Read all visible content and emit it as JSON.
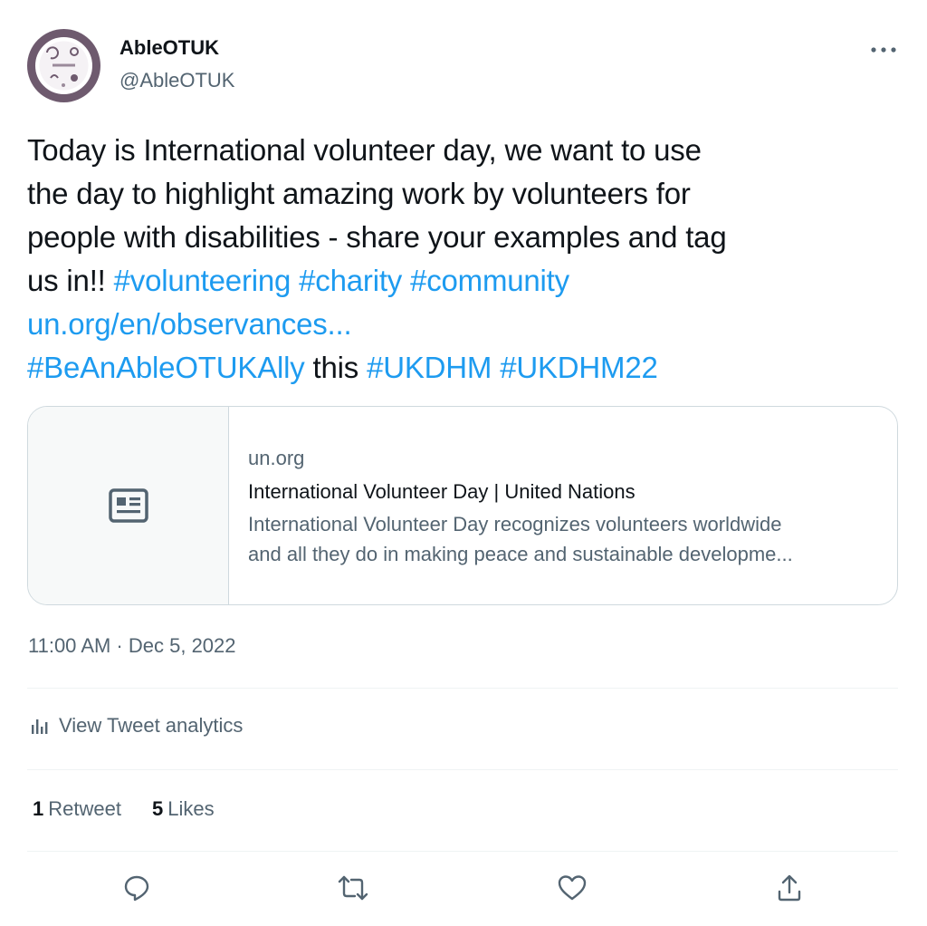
{
  "author": {
    "display_name": "AbleOTUK",
    "handle": "@AbleOTUK",
    "avatar_color": "#6e5a6e"
  },
  "tweet": {
    "line1": "Today is International volunteer day, we want to use",
    "line2": "the day to highlight amazing work by volunteers for",
    "line3": "people with disabilities - share your examples and tag",
    "line4_text": "us in!! ",
    "hashtag_volunteering": "#volunteering",
    "hashtag_charity": "#charity",
    "hashtag_community": "#community",
    "url": "un.org/en/observances...",
    "hashtag_beanally": "#BeAnAbleOTUKAlly",
    "this_word": " this ",
    "hashtag_ukdhm": "#UKDHM",
    "hashtag_ukdhm22": "#UKDHM22"
  },
  "card": {
    "domain": "un.org",
    "title": "International Volunteer Day | United Nations",
    "description_line1": "International Volunteer Day recognizes volunteers worldwide",
    "description_line2": "and all they do in making peace and sustainable developme..."
  },
  "timestamp": "11:00 AM · Dec 5, 2022",
  "analytics_label": "View Tweet analytics",
  "stats": {
    "retweets_count": "1",
    "retweets_label": "Retweet",
    "likes_count": "5",
    "likes_label": "Likes"
  },
  "icons": {
    "more": "more-horizontal-icon",
    "analytics": "bar-chart-icon",
    "card_thumb": "article-icon",
    "reply": "reply-icon",
    "retweet": "retweet-icon",
    "like": "heart-icon",
    "share": "share-icon"
  },
  "colors": {
    "link": "#1d9bf0",
    "text": "#0f1419",
    "secondary": "#536471",
    "border": "#cfd9de"
  }
}
